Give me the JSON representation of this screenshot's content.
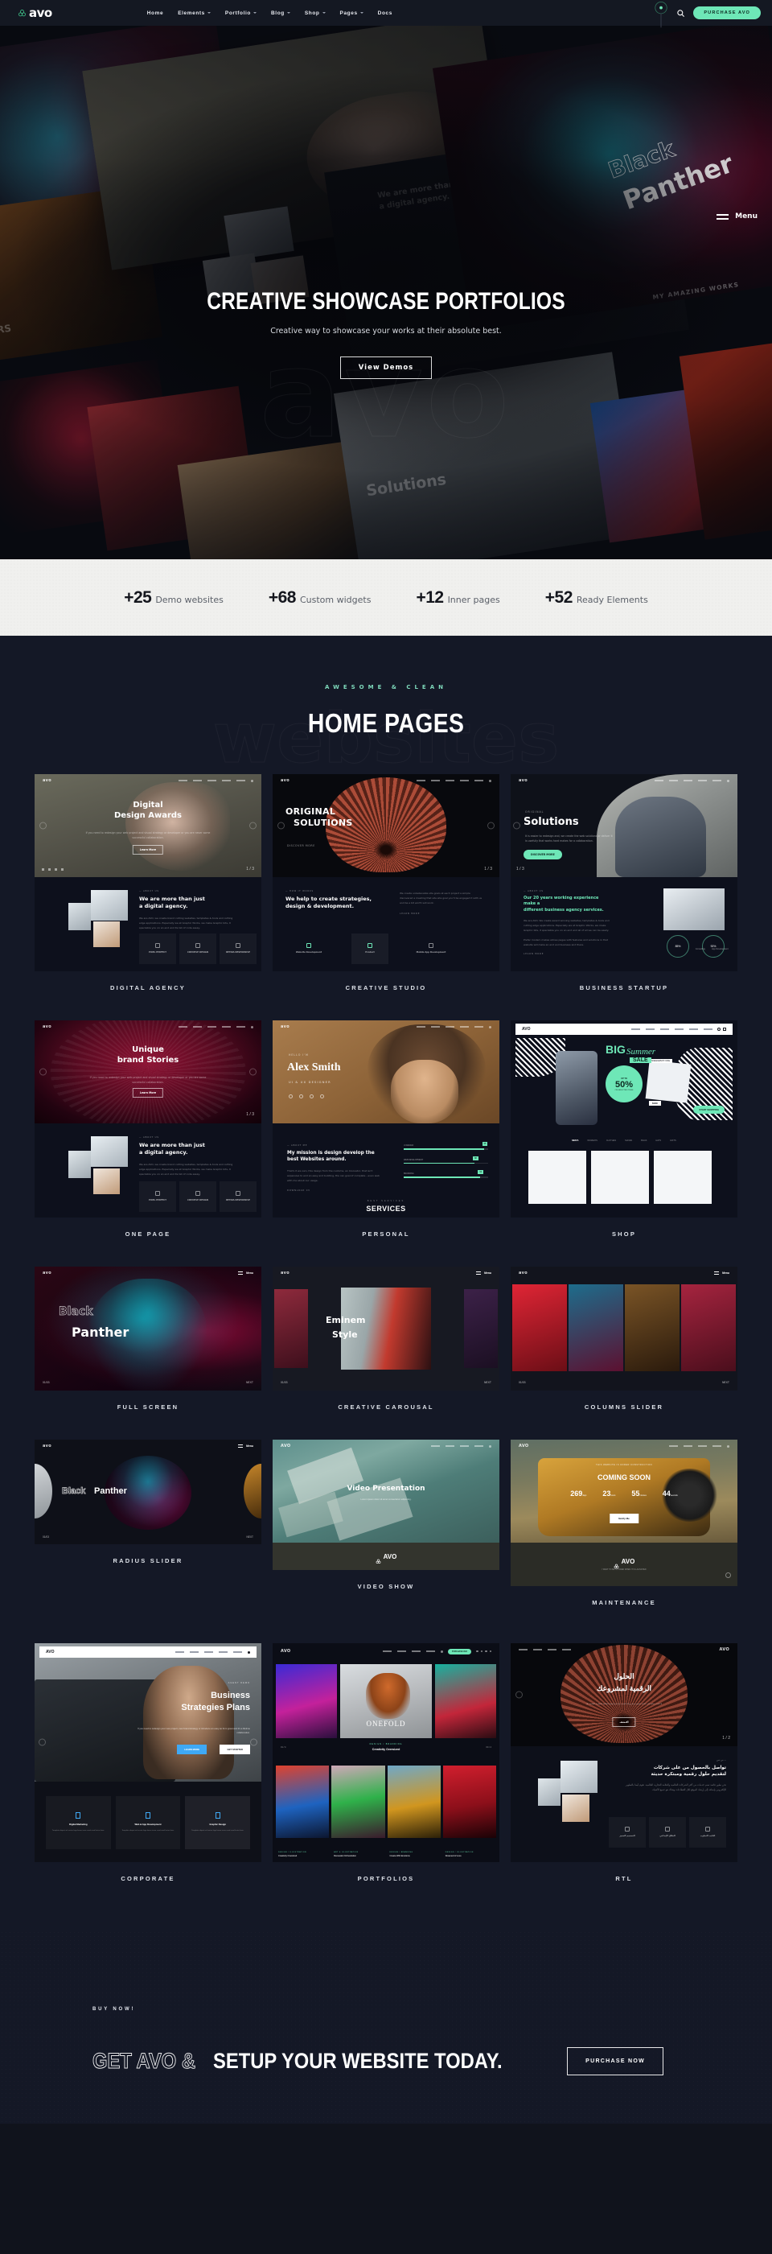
{
  "navbar": {
    "logo_text": "avo",
    "logo_icon": "trinity-knot-icon",
    "links": [
      {
        "label": "Home",
        "has_caret": false
      },
      {
        "label": "Elements",
        "has_caret": true
      },
      {
        "label": "Portfolio",
        "has_caret": true
      },
      {
        "label": "Blog",
        "has_caret": true
      },
      {
        "label": "Shop",
        "has_caret": true
      },
      {
        "label": "Pages",
        "has_caret": true
      },
      {
        "label": "Docs",
        "has_caret": false
      }
    ],
    "search_icon": "search-icon",
    "purchase_label": "PURCHASE AVO"
  },
  "hero": {
    "watermark": "avo",
    "title": "CREATIVE SHOWCASE PORTFOLIOS",
    "subtitle": "Creative way to showcase your works at their absolute best.",
    "button_label": "View Demos",
    "menu_label": "Menu",
    "collage": {
      "digital_line1": "Digital",
      "digital_line2": "Design Awards",
      "about_heading_line1": "We are more than just",
      "about_heading_line2": "a digital agency.",
      "panther_outline": "Black",
      "panther_solid": "Panther",
      "solutions": "Solutions",
      "amazing_works": "MY AMAZING WORKS",
      "left_edge": "RS"
    }
  },
  "stats": [
    {
      "num": "+25",
      "label": "Demo websites"
    },
    {
      "num": "+68",
      "label": "Custom widgets"
    },
    {
      "num": "+12",
      "label": "Inner pages"
    },
    {
      "num": "+52",
      "label": "Ready Elements"
    }
  ],
  "homepages": {
    "eyebrow": "AWESOME & CLEAN",
    "title": "HOME PAGES",
    "watermark": "websites",
    "demos": [
      {
        "label": "DIGITAL AGENCY",
        "mini_logo": "avo",
        "hero_title_1": "Digital",
        "hero_title_2": "Design Awards",
        "hero_sub": "If you need to redesign your web project and visual strategy or developer or you are never some successful collaboration.",
        "hero_btn": "Learn More",
        "about_eyebrow": "— ABOUT US",
        "about_h1": "We are more than just",
        "about_h2": "a digital agency.",
        "about_p": "We are AVO, we create brand cutting websites, templates & tools and cutting edge applications. Especially we at Graphic Works, we make Graphic bits, it specialize you on an end and its list of code essay.",
        "cards": [
          {
            "title": "PIXEL\nPERFECT"
          },
          {
            "title": "CREATIVE\nDESIGN"
          },
          {
            "title": "RETINA\nRESPONSIVE"
          }
        ]
      },
      {
        "label": "CREATIVE STUDIO",
        "mini_logo": "avo",
        "hero_title_1": "ORIGINAL",
        "hero_title_2": "SOLUTIONS",
        "hero_sub": "DISCOVER MORE",
        "about_eyebrow": "— HOW IT WORKS",
        "about_h1": "We help to create strategies,",
        "about_h2": "design & development.",
        "about_p": "We create unbelievable site goals at each project a simple discovered a meeting that site site goal you'll be engaged it with us and be a bit worth will work.",
        "about_link": "LEARN MORE",
        "cards": [
          {
            "title": "Website\nDevelopment"
          },
          {
            "title": "Product"
          },
          {
            "title": "Mobile App\nDevelopment"
          }
        ]
      },
      {
        "label": "BUSINESS STARTUP",
        "mini_logo": "avo",
        "hero_eyebrow": "ORIGINAL",
        "hero_title_1": "Solutions",
        "hero_sub": "It is easier to redesign and, we create the web solutions or deliver it is usefully that works hard makes for a collaboration.",
        "hero_btn": "DISCOVER MORE",
        "about_eyebrow": "— ABOUT US",
        "about_h1": "Our 20 years working experience make a",
        "about_h2": "different business agency services.",
        "about_p": "We are AVO. We create award winning websites, templates & tools and cutting edge applications. Especially we at Graphic Works, we make Graphic bits, it specialize you on an end and all of all we can be easily.",
        "about_p2": "Prefer modern makes allows pages with features and solutions in that website will make an end and business and there.",
        "about_link": "LEARN MORE",
        "stat1_value": "85%",
        "stat1_label": "Consulting",
        "stat2_value": "92%",
        "stat2_label": "App Development"
      },
      {
        "label": "ONE PAGE",
        "mini_logo": "avo",
        "hero_title_1": "Unique",
        "hero_title_2": "brand Stories",
        "hero_sub": "If you need to redesign your web project and visual strategy or developer or you are some successful collaboration.",
        "hero_btn": "Learn More",
        "about_eyebrow": "— ABOUT US",
        "about_h1": "We are more than just",
        "about_h2": "a digital agency.",
        "about_p": "We are AVO, we create brand cutting websites, templates & tools and cutting edge applications. Especially we at Graphic Works, we make Graphic bits, it specialize you on an end and its list of code essay.",
        "cards": [
          {
            "title": "PIXEL\nPERFECT"
          },
          {
            "title": "CREATIVE\nDESIGN"
          },
          {
            "title": "RETINA\nRESPONSIVE"
          }
        ]
      },
      {
        "label": "PERSONAL",
        "mini_logo": "avo",
        "hero_eyebrow": "HELLO I'M",
        "hero_title_1": "Alex Smith",
        "hero_sub": "UI & UX DESIGNER",
        "about_eyebrow": "— ABOUT ME",
        "about_h1": "My mission is design develop the",
        "about_h2": "best Websites around.",
        "about_p": "That's it we own, this design from the customs, an Innovator, that isn't expensive to end an easy and building, the can goal of complete - even web with me about our usage.",
        "about_link": "DOWNLOAD CV",
        "services_eyebrow": "BEST SERVICES",
        "services_title": "SERVICES",
        "skills": [
          {
            "label": "UI DESIGN",
            "value": "95"
          },
          {
            "label": "WEB DEVELOPMENT",
            "value": "88"
          },
          {
            "label": "BRANDING",
            "value": "92"
          }
        ]
      },
      {
        "label": "SHOP",
        "mini_logo": "AVO",
        "promo_big": "BIG",
        "promo_script": "Summer",
        "promo_sale": "SALE",
        "promo_upto": "UP TO",
        "promo_percent": "50%",
        "promo_selected": "ON SELECTED ITEMS",
        "promo_sneakers": "SNEAKERS BY NIKE",
        "promo_price": "$189",
        "promo_btn": "START SHOPPING",
        "categories": [
          "MEN'S",
          "WOMEN'S",
          "CLOTHES",
          "SHOES",
          "BAGS",
          "HATS",
          "GIFTS"
        ]
      },
      {
        "label": "FULL SCREEN",
        "mini_logo": "avo",
        "menu_label": "Menu",
        "hero_title_1": "Black",
        "hero_title_2": "Panther",
        "counter": "01/03"
      },
      {
        "label": "CREATIVE CAROUSAL",
        "mini_logo": "avo",
        "menu_label": "Menu",
        "hero_title_1": "Eminem",
        "hero_title_2": "Style",
        "counter": "01/03"
      },
      {
        "label": "COLUMNS SLIDER",
        "mini_logo": "avo",
        "menu_label": "Menu",
        "counter": "01/03"
      },
      {
        "label": "RADIUS SLIDER",
        "mini_logo": "avo",
        "menu_label": "Menu",
        "hero_title_1": "Black",
        "hero_title_2": "Panther",
        "counter": "01/03"
      },
      {
        "label": "VIDEO SHOW",
        "mini_logo": "AVO",
        "hero_title": "Video Presentation",
        "hero_sub": "Lorem ipsum dolor sit amet consectetur adipiscing.",
        "footer_logo": "AVO"
      },
      {
        "label": "MAINTENANCE",
        "mini_logo": "AVO",
        "eyebrow": "THIS WEBSITE IS UNDER CONSTRUCTION",
        "heading": "COMING SOON",
        "countdown": [
          {
            "value": "269",
            "unit": "days"
          },
          {
            "value": "23",
            "unit": "hours"
          },
          {
            "value": "55",
            "unit": "minutes"
          },
          {
            "value": "44",
            "unit": "seconds"
          }
        ],
        "btn": "Notify Me",
        "footer_logo": "AVO",
        "footer_note": "I WANT TO BE NOTIFIED WHEN IT IS LAUNCHED"
      },
      {
        "label": "CORPORATE",
        "mini_logo": "AVO",
        "hero_eyebrow": "AGENT DEMO",
        "hero_title_1": "Business",
        "hero_title_2": "Strategies Plans",
        "hero_sub": "If you need to redesign your new project, new brand strategy or introduce an easy as from great and it's a lifetime collaboration.",
        "btn_primary": "LEARN MORE",
        "btn_secondary": "GET STARTED",
        "cards": [
          {
            "title": "Digital Marketing",
            "text": "Template aliquet vel auctor fuga lorem issue cond cond luctus laon."
          },
          {
            "title": "Web & App Development",
            "text": "Template aliquet vel auctor fuga lorem issue cond cond luctus laon."
          },
          {
            "title": "Graphic Design",
            "text": "Template aliquet vel auctor fuga lorem issue cond cond luctus laon."
          }
        ]
      },
      {
        "label": "PORTFOLIOS",
        "mini_logo": "AVO",
        "purchase_btn": "PURCHASE AVO",
        "center_caption_eyebrow": "DESIGN / BRANDING",
        "center_caption": "Creativity Oversized",
        "center_word": "ONEFOLD",
        "counter_left": "01 / 4",
        "counter_right": "04 / 4",
        "items": [
          {
            "eyebrow": "DESIGN / ILLUSTRATION",
            "title": "Creativity Oversized"
          },
          {
            "eyebrow": "ART & ILLUSTRATION",
            "title": "Renewals Orchestration"
          },
          {
            "eyebrow": "DESIGN / BRANDING",
            "title": "Create With Emotions"
          },
          {
            "eyebrow": "DESIGN / ILLUSTRATION",
            "title": "Dreamed of Love"
          }
        ]
      },
      {
        "label": "RTL",
        "mini_logo": "AVO",
        "hero_title_1": "الحلول",
        "hero_title_2": "الرقمية لمشروعك",
        "hero_sub": "إذا كنت بحاجة إلى إعادة تصميم مشروعك الجديد أو استراتيجية العلامة التجارية الخاصة بك",
        "hero_btn": "اكتشف",
        "counter": "1 / 2",
        "about_eyebrow": "— من نحن",
        "about_h1": "تواصل بالحصول من على شركات",
        "about_h2": "لتقديم حلول رقمية ومبتكرة حديثة",
        "about_p": "نحن نطور قائمة تضم خدمات من أكثر الشركات العالمية والعلامة التجارية العالمية. نقوم أيضا بالتطوير الإلكتروني بإضافة إلى إرشاد الموقع لكل القطاعات وهناك هو جميع الأشياء.",
        "cards": [
          {
            "title": "التصميم\nالمميز"
          },
          {
            "title": "الخلاق\nالإبداعي"
          },
          {
            "title": "الثابت\nالتجاوب"
          }
        ]
      }
    ]
  },
  "cta": {
    "eyebrow": "BUY NOW!",
    "title_outline": "GET AVO &",
    "title_solid": "SETUP YOUR WEBSITE TODAY.",
    "button": "PURCHASE NOW"
  },
  "colors": {
    "accent": "#6ee7b7",
    "bg_dark": "#10131c",
    "bg_section": "#141826",
    "stats_bg": "#f0f0ee"
  }
}
